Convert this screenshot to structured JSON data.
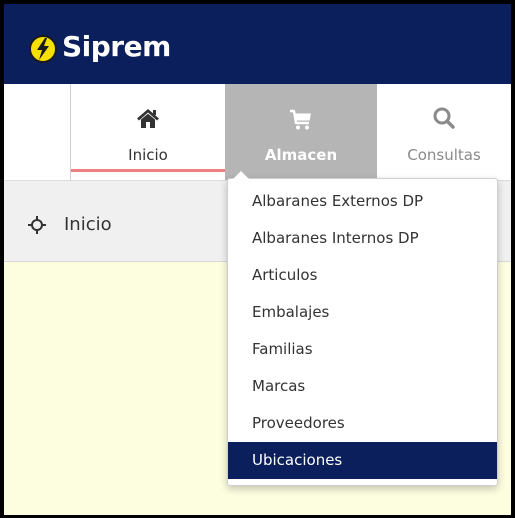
{
  "app": {
    "title": "Siprem",
    "brand_color": "#0a1f5c",
    "logo_icon": "lightning-coin-icon"
  },
  "nav": {
    "items": [
      {
        "label": "Inicio",
        "icon": "home-icon",
        "state": "current"
      },
      {
        "label": "Almacen",
        "icon": "cart-icon",
        "state": "open"
      },
      {
        "label": "Consultas",
        "icon": "search-icon",
        "state": "default"
      }
    ],
    "current_underline_color": "#f08080",
    "open_bg_color": "#b5b5b5"
  },
  "breadcrumb": {
    "icon": "crosshair-icon",
    "label": "Inicio"
  },
  "dropdown": {
    "items": [
      {
        "label": "Albaranes Externos DP"
      },
      {
        "label": "Albaranes Internos DP"
      },
      {
        "label": "Articulos"
      },
      {
        "label": "Embalajes"
      },
      {
        "label": "Familias"
      },
      {
        "label": "Marcas"
      },
      {
        "label": "Proveedores"
      },
      {
        "label": "Ubicaciones",
        "highlighted": true
      }
    ],
    "highlight_color": "#0a1f5c"
  }
}
